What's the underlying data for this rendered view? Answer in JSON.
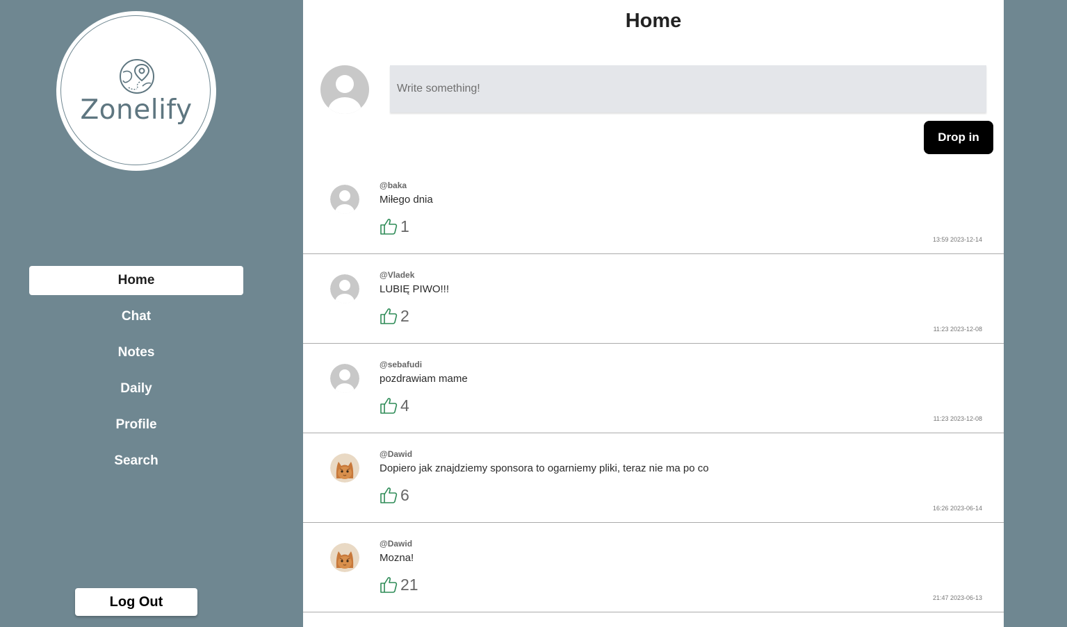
{
  "app": {
    "name": "Zonelify"
  },
  "sidebar": {
    "nav": [
      {
        "label": "Home",
        "active": true
      },
      {
        "label": "Chat",
        "active": false
      },
      {
        "label": "Notes",
        "active": false
      },
      {
        "label": "Daily",
        "active": false
      },
      {
        "label": "Profile",
        "active": false
      },
      {
        "label": "Search",
        "active": false
      }
    ],
    "logout_label": "Log Out"
  },
  "main": {
    "title": "Home",
    "composer": {
      "placeholder": "Write something!",
      "submit_label": "Drop in"
    },
    "posts": [
      {
        "user": "@baka",
        "text": "Miłego dnia",
        "likes": "1",
        "time": "13:59 2023-12-14",
        "avatar": "default-avatar"
      },
      {
        "user": "@Vladek",
        "text": "LUBIĘ PIWO!!!",
        "likes": "2",
        "time": "11:23 2023-12-08",
        "avatar": "default-avatar"
      },
      {
        "user": "@sebafudi",
        "text": "pozdrawiam mame",
        "likes": "4",
        "time": "11:23 2023-12-08",
        "avatar": "default-avatar"
      },
      {
        "user": "@Dawid",
        "text": "Dopiero jak znajdziemy sponsora to ogarniemy pliki, teraz nie ma po co",
        "likes": "6",
        "time": "16:26 2023-06-14",
        "avatar": "cat-avatar"
      },
      {
        "user": "@Dawid",
        "text": "Mozna!",
        "likes": "21",
        "time": "21:47 2023-06-13",
        "avatar": "cat-avatar"
      }
    ]
  },
  "colors": {
    "sidebar_bg": "#6f8791",
    "accent_like": "#2e8b57",
    "button_dark": "#000000"
  }
}
